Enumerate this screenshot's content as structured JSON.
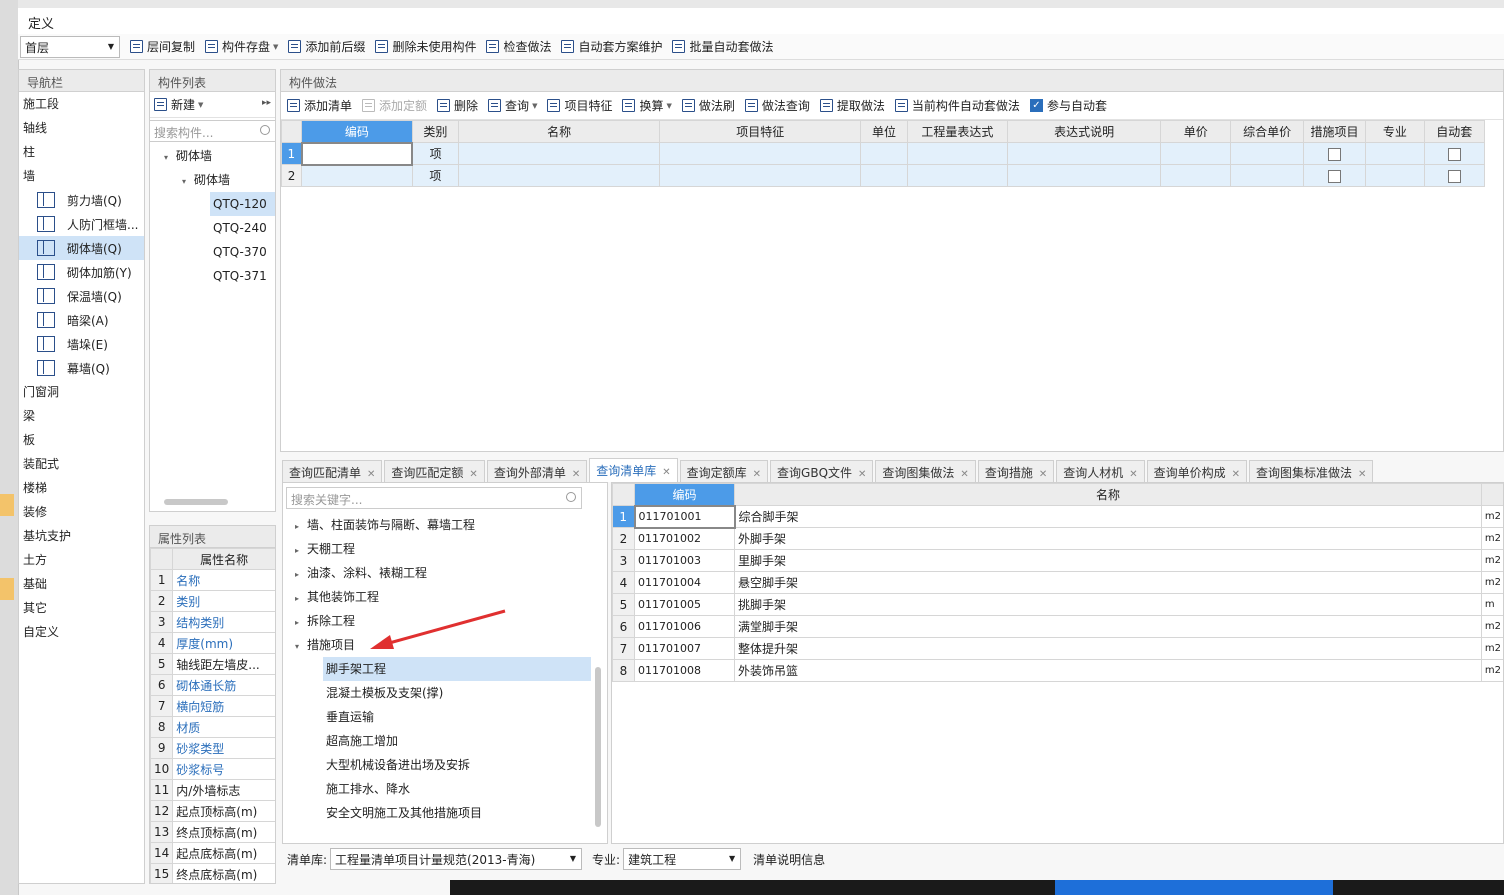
{
  "window": {
    "title": "定义"
  },
  "toolbar": {
    "floor": "首层",
    "buttons": [
      "层间复制",
      "构件存盘",
      "添加前后缀",
      "删除未使用构件",
      "检查做法",
      "自动套方案维护",
      "批量自动套做法"
    ]
  },
  "nav": {
    "title": "导航栏",
    "items_top": [
      "施工段",
      "轴线",
      "柱",
      "墙"
    ],
    "wall_sub": [
      {
        "label": "剪力墙(Q)",
        "icon": "shear-wall-icon"
      },
      {
        "label": "人防门框墙...",
        "icon": "door-frame-wall-icon"
      },
      {
        "label": "砌体墙(Q)",
        "icon": "masonry-wall-icon"
      },
      {
        "label": "砌体加筋(Y)",
        "icon": "masonry-rebar-icon"
      },
      {
        "label": "保温墙(Q)",
        "icon": "insulation-wall-icon"
      },
      {
        "label": "暗梁(A)",
        "icon": "hidden-beam-icon"
      },
      {
        "label": "墙垛(E)",
        "icon": "wall-pier-icon"
      },
      {
        "label": "幕墙(Q)",
        "icon": "curtain-wall-icon"
      }
    ],
    "items_bottom": [
      "门窗洞",
      "梁",
      "板",
      "装配式",
      "楼梯",
      "装修",
      "基坑支护",
      "土方",
      "基础",
      "其它",
      "自定义"
    ]
  },
  "complist": {
    "title": "构件列表",
    "new_label": "新建",
    "search_placeholder": "搜索构件...",
    "tree_l1": "砌体墙",
    "tree_l2": "砌体墙",
    "leaves": [
      "QTQ-120",
      "QTQ-240",
      "QTQ-370",
      "QTQ-371"
    ]
  },
  "props": {
    "title": "属性列表",
    "col": "属性名称",
    "rows": [
      "名称",
      "类别",
      "结构类别",
      "厚度(mm)",
      "轴线距左墙皮...",
      "砌体通长筋",
      "横向短筋",
      "材质",
      "砂浆类型",
      "砂浆标号",
      "内/外墙标志",
      "起点顶标高(m)",
      "终点顶标高(m)",
      "起点底标高(m)",
      "终点底标高(m)"
    ],
    "blue": [
      true,
      true,
      true,
      true,
      false,
      true,
      true,
      true,
      true,
      true,
      false,
      false,
      false,
      false,
      false
    ]
  },
  "method": {
    "title": "构件做法",
    "toolbar": [
      "添加清单",
      "添加定额",
      "删除",
      "查询",
      "项目特征",
      "换算",
      "做法刷",
      "做法查询",
      "提取做法",
      "当前构件自动套做法"
    ],
    "auto_label": "参与自动套",
    "columns": [
      "编码",
      "类别",
      "名称",
      "项目特征",
      "单位",
      "工程量表达式",
      "表达式说明",
      "单价",
      "综合单价",
      "措施项目",
      "专业",
      "自动套"
    ],
    "rows": [
      {
        "n": "1",
        "type": "项"
      },
      {
        "n": "2",
        "type": "项"
      }
    ]
  },
  "tabs": [
    "查询匹配清单",
    "查询匹配定额",
    "查询外部清单",
    "查询清单库",
    "查询定额库",
    "查询GBQ文件",
    "查询图集做法",
    "查询措施",
    "查询人材机",
    "查询单价构成",
    "查询图集标准做法"
  ],
  "query": {
    "search_placeholder": "搜索关键字...",
    "tree": [
      {
        "label": "墙、柱面装饰与隔断、幕墙工程",
        "lvl": 0,
        "caret": "▸"
      },
      {
        "label": "天棚工程",
        "lvl": 0,
        "caret": "▸"
      },
      {
        "label": "油漆、涂料、裱糊工程",
        "lvl": 0,
        "caret": "▸"
      },
      {
        "label": "其他装饰工程",
        "lvl": 0,
        "caret": "▸"
      },
      {
        "label": "拆除工程",
        "lvl": 0,
        "caret": "▸"
      },
      {
        "label": "措施项目",
        "lvl": 0,
        "caret": "▾"
      },
      {
        "label": "脚手架工程",
        "lvl": 1,
        "caret": ""
      },
      {
        "label": "混凝土模板及支架(撑)",
        "lvl": 1,
        "caret": ""
      },
      {
        "label": "垂直运输",
        "lvl": 1,
        "caret": ""
      },
      {
        "label": "超高施工增加",
        "lvl": 1,
        "caret": ""
      },
      {
        "label": "大型机械设备进出场及安拆",
        "lvl": 1,
        "caret": ""
      },
      {
        "label": "施工排水、降水",
        "lvl": 1,
        "caret": ""
      },
      {
        "label": "安全文明施工及其他措施项目",
        "lvl": 1,
        "caret": ""
      }
    ],
    "result_cols": [
      "编码",
      "名称"
    ],
    "results": [
      {
        "n": "1",
        "code": "011701001",
        "name": "综合脚手架",
        "unit": "m2"
      },
      {
        "n": "2",
        "code": "011701002",
        "name": "外脚手架",
        "unit": "m2"
      },
      {
        "n": "3",
        "code": "011701003",
        "name": "里脚手架",
        "unit": "m2"
      },
      {
        "n": "4",
        "code": "011701004",
        "name": "悬空脚手架",
        "unit": "m2"
      },
      {
        "n": "5",
        "code": "011701005",
        "name": "挑脚手架",
        "unit": "m"
      },
      {
        "n": "6",
        "code": "011701006",
        "name": "满堂脚手架",
        "unit": "m2"
      },
      {
        "n": "7",
        "code": "011701007",
        "name": "整体提升架",
        "unit": "m2"
      },
      {
        "n": "8",
        "code": "011701008",
        "name": "外装饰吊篮",
        "unit": "m2"
      }
    ],
    "footer": {
      "lib_label": "清单库:",
      "lib_value": "工程量清单项目计量规范(2013-青海)",
      "major_label": "专业:",
      "major_value": "建筑工程",
      "desc": "清单说明信息"
    }
  },
  "colors": {
    "accent": "#4c9be8",
    "selected_row": "#cfe3f7",
    "arrow": "#e03030"
  }
}
